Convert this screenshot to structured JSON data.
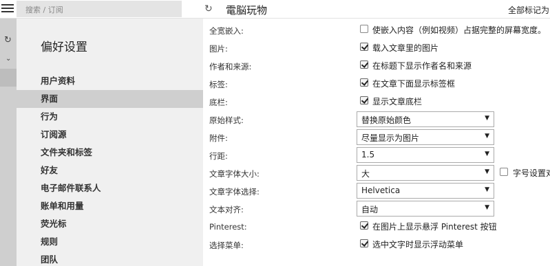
{
  "background": {
    "search_placeholder": "搜索 / 订阅",
    "feed_title": "電脳玩物",
    "mark_all": "全部标记为"
  },
  "prefs": {
    "title": "偏好设置",
    "nav": [
      {
        "label": "用户资料"
      },
      {
        "label": "界面",
        "active": true
      },
      {
        "label": "行为"
      },
      {
        "label": "订阅源"
      },
      {
        "label": "文件夹和标签"
      },
      {
        "label": "好友"
      },
      {
        "label": "电子邮件联系人"
      },
      {
        "label": "账单和用量"
      },
      {
        "label": "荧光标"
      },
      {
        "label": "规则"
      },
      {
        "label": "团队"
      }
    ],
    "settings": {
      "fullwidth": {
        "label": "全宽嵌入:",
        "option": "使嵌入内容（例如视频）占据完整的屏幕宽度。",
        "checked": false
      },
      "images": {
        "label": "图片:",
        "option": "载入文章里的图片",
        "checked": true
      },
      "author": {
        "label": "作者和来源:",
        "option": "在标题下显示作者名和来源",
        "checked": true
      },
      "tags": {
        "label": "标签:",
        "option": "在文章下面显示标签框",
        "checked": true
      },
      "footer": {
        "label": "底栏:",
        "option": "显示文章底栏",
        "checked": true
      },
      "original_style": {
        "label": "原始样式:",
        "value": "替换原始颜色"
      },
      "attachments": {
        "label": "附件:",
        "value": "尽量显示为图片"
      },
      "line_height": {
        "label": "行距:",
        "value": "1.5"
      },
      "font_size": {
        "label": "文章字体大小:",
        "value": "大",
        "extra_option": "字号设置对",
        "extra_checked": false
      },
      "font_family": {
        "label": "文章字体选择:",
        "value": "Helvetica"
      },
      "text_align": {
        "label": "文本对齐:",
        "value": "自动"
      },
      "pinterest": {
        "label": "Pinterest:",
        "option": "在图片上显示悬浮 Pinterest 按钮",
        "checked": true
      },
      "selection_menu": {
        "label": "选择菜单:",
        "option": "选中文字时显示浮动菜单",
        "checked": true
      }
    }
  }
}
